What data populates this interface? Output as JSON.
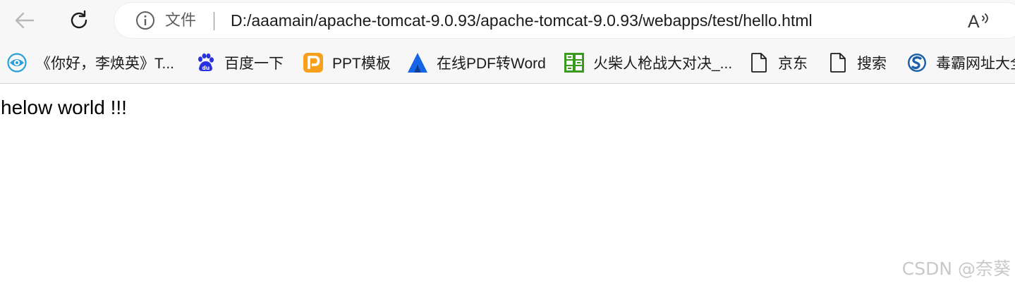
{
  "browser": {
    "address_bar": {
      "scheme_label": "文件",
      "url": "D:/aaamain/apache-tomcat-9.0.93/apache-tomcat-9.0.93/webapps/test/hello.html"
    },
    "icons": {
      "back": "back-arrow-icon",
      "reload": "reload-icon",
      "info": "info-icon",
      "read_aloud": "read-aloud-icon"
    }
  },
  "bookmarks": [
    {
      "label": "《你好，李焕英》T...",
      "icon": "eye-logo-icon"
    },
    {
      "label": "百度一下",
      "icon": "baidu-paw-icon"
    },
    {
      "label": "PPT模板",
      "icon": "ppt-p-icon"
    },
    {
      "label": "在线PDF转Word",
      "icon": "triangle-a-icon"
    },
    {
      "label": "火柴人枪战大对决_...",
      "icon": "game-grid-icon"
    },
    {
      "label": "京东",
      "icon": "page-icon"
    },
    {
      "label": "搜索",
      "icon": "page-icon"
    },
    {
      "label": "毒霸网址大全",
      "icon": "globe-s-icon"
    }
  ],
  "page": {
    "body_text": "helow world !!!"
  },
  "watermark": "CSDN @奈葵",
  "colors": {
    "toolbar_bg": "#f7f7f7",
    "address_bg": "#ffffff",
    "text": "#1b1b1b",
    "baidu_blue": "#2932e1",
    "ppt_orange": "#f7a11a",
    "pdf_blue": "#1565e8",
    "game_green": "#3a9a1f",
    "eye_teal": "#2aa1d8"
  }
}
